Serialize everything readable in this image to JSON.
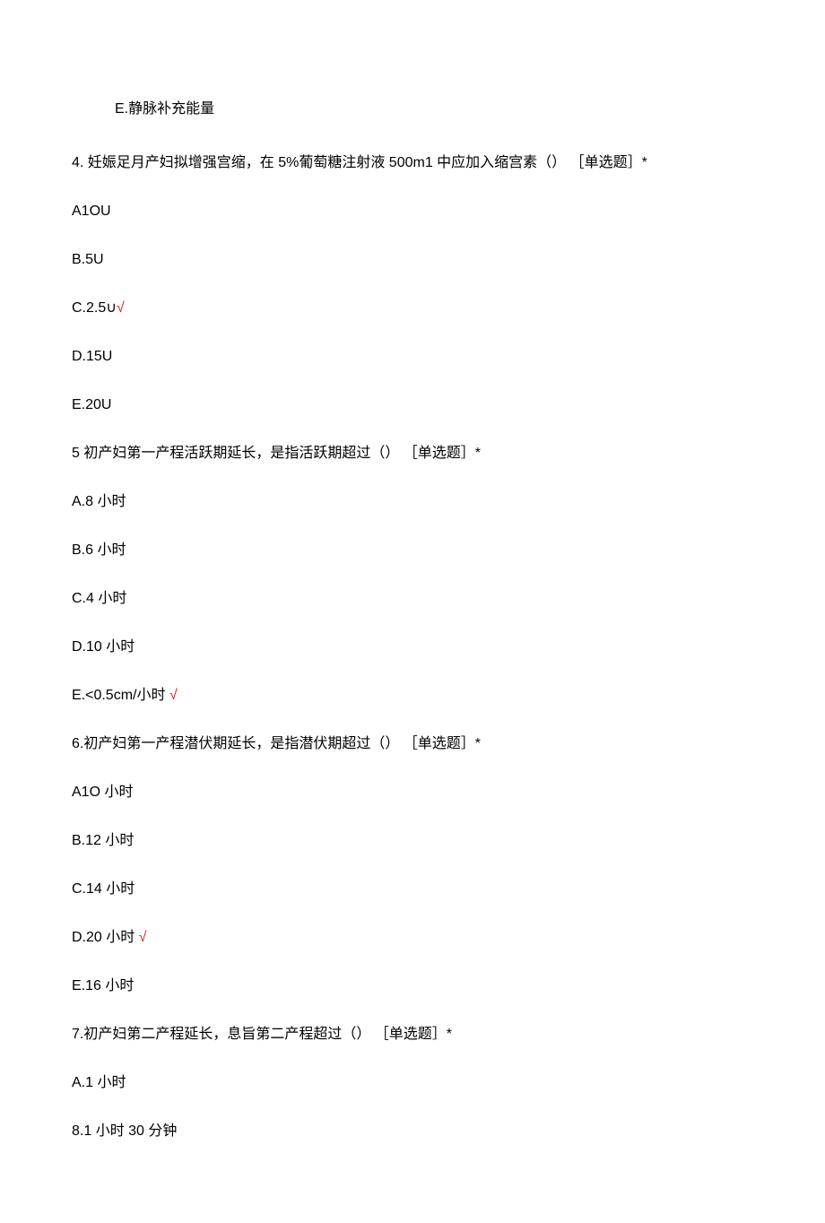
{
  "optE_prev": "E.静脉补充能量",
  "q4": {
    "stem": "4. 妊娠足月产妇拟增强宫缩，在 5%葡萄糖注射液 500m1 中应加入缩宫素（） ［单选题］*",
    "A": "A1OU",
    "B": "B.5U",
    "C": "C.2.5∪",
    "Cmark": "√",
    "D": "D.15U",
    "E": "E.20U"
  },
  "q5": {
    "stem": "5 初产妇第一产程活跃期延长，是指活跃期超过（） ［单选题］*",
    "A": "A.8 小时",
    "B": "B.6 小时",
    "C": "C.4 小时",
    "D": "D.10 小时",
    "E": "E.<0.5cm/小时 ",
    "Emark": "√"
  },
  "q6": {
    "stem": "6.初产妇第一产程潜伏期延长，是指潜伏期超过（） ［单选题］*",
    "A": "A1O 小时",
    "B": "B.12 小时",
    "C": "C.14 小时",
    "D": "D.20 小时 ",
    "Dmark": "√",
    "E": "E.16 小时"
  },
  "q7": {
    "stem": "7.初产妇第二产程延长，息旨第二产程超过（） ［单选题］*",
    "A": "A.1 小时",
    "B": "8.1   小时 30 分钟"
  }
}
